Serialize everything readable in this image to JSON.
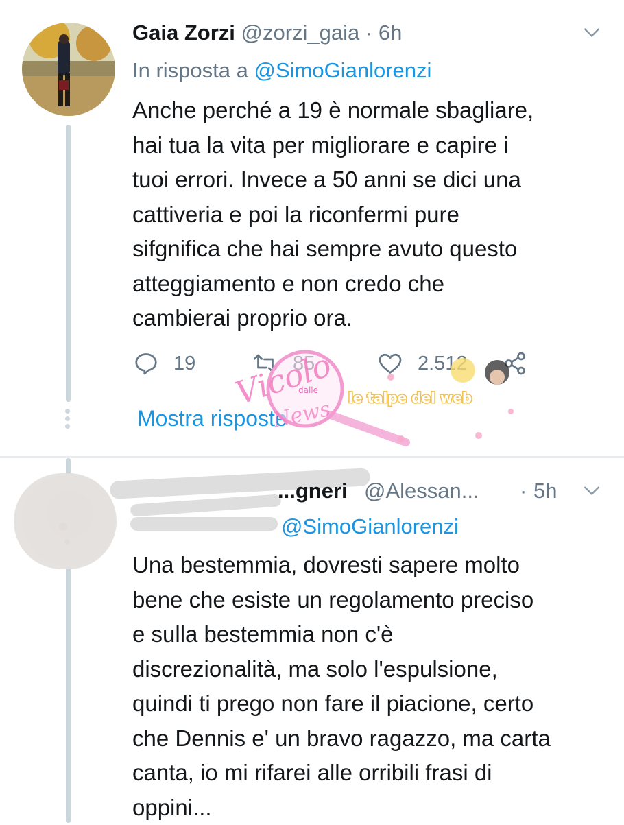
{
  "tweet1": {
    "name": "Gaia Zorzi",
    "handle": "@zorzi_gaia",
    "separator": "·",
    "time": "6h",
    "reply_prefix": "In risposta a",
    "reply_mention": "@SimoGianlorenzi",
    "text": "Anche perché a 19 è normale sbagliare,\nhai tua la vita per migliorare e capire i\ntuoi errori. Invece a 50 anni se dici una\ncattiveria e poi la riconfermi pure\nsifgnifica che hai sempre avuto questo\natteggiamento e non credo che\ncambierai proprio ora.",
    "replies": "19",
    "retweets": "85",
    "likes": "2.512",
    "show_replies": "Mostra risposte"
  },
  "tweet2": {
    "name_visible": "...gneri",
    "handle": "@Alessan...",
    "separator": "·",
    "time": "5h",
    "reply_mention": "@SimoGianlorenzi",
    "text": "Una bestemmia, dovresti sapere molto\nbene che esiste un regolamento preciso\ne sulla bestemmia non c'è\ndiscrezionalità, ma solo l'espulsione,\nquindi ti prego non fare il piacione, certo\nche Dennis e' un bravo ragazzo, ma carta\ncanta, io mi rifarei alle orribili frasi di\noppini..."
  },
  "watermark": {
    "text_main": "Vicolo",
    "text_small": "dalle",
    "text_end": "News",
    "text_right": "le talpe del web"
  },
  "colors": {
    "link": "#1b95e0",
    "muted": "#657786",
    "text": "#14171a",
    "line": "#ccd6dd"
  },
  "icons": [
    "chevron-down-icon",
    "reply-icon",
    "retweet-icon",
    "like-icon",
    "share-icon"
  ]
}
